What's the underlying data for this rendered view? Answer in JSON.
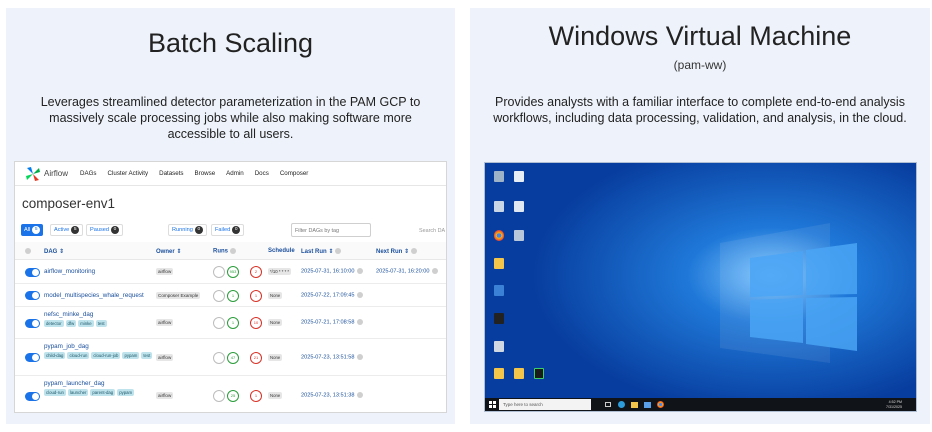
{
  "left_panel": {
    "title": "Batch Scaling",
    "description": "Leverages streamlined detector parameterization in the PAM GCP to massively scale processing jobs while also making software more accessible to all users.",
    "airflow": {
      "brand": "Airflow",
      "nav": [
        "DAGs",
        "Cluster Activity",
        "Datasets",
        "Browse",
        "Admin",
        "Docs",
        "Composer"
      ],
      "environment": "composer-env1",
      "filters": {
        "all": "All",
        "all_count": "5",
        "active": "Active",
        "active_count": "5",
        "paused": "Paused",
        "paused_count": "0",
        "running": "Running",
        "running_count": "0",
        "failed": "Failed",
        "failed_count": "0"
      },
      "filter_tags_placeholder": "Filter DAGs by tag",
      "search_placeholder": "Search DA",
      "columns": {
        "dag": "DAG ⇕",
        "owner": "Owner ⇕",
        "runs": "Runs",
        "schedule": "Schedule",
        "last_run": "Last Run ⇕",
        "next_run": "Next Run ⇕"
      },
      "rows": [
        {
          "name": "airflow_monitoring",
          "tags": [],
          "owner": "airflow",
          "success": "953",
          "failed": "2",
          "schedule": "*/10 * * * *",
          "last_run": "2025-07-31, 16:10:00",
          "next_run": "2025-07-31, 16:20:00"
        },
        {
          "name": "model_multispecies_whale_request",
          "tags": [],
          "owner": "Composer Example",
          "success": "1",
          "failed": "1",
          "schedule": "None",
          "last_run": "2025-07-22, 17:09:45",
          "next_run": ""
        },
        {
          "name": "nefsc_minke_dag",
          "tags": [
            "detector",
            "dfw",
            "minke",
            "test"
          ],
          "owner": "airflow",
          "success": "1",
          "failed": "10",
          "schedule": "None",
          "last_run": "2025-07-21, 17:08:58",
          "next_run": ""
        },
        {
          "name": "pypam_job_dag",
          "tags": [
            "child-dag",
            "cloud-run",
            "cloud-run-job",
            "pypam",
            "test"
          ],
          "owner": "airflow",
          "success": "47",
          "failed": "21",
          "schedule": "None",
          "last_run": "2025-07-23, 13:51:58",
          "next_run": ""
        },
        {
          "name": "pypam_launcher_dag",
          "tags": [
            "cloud-run",
            "launcher",
            "parent-dag",
            "pypam"
          ],
          "owner": "airflow",
          "success": "25",
          "failed": "1",
          "schedule": "None",
          "last_run": "2025-07-23, 13:51:38",
          "next_run": ""
        }
      ]
    }
  },
  "right_panel": {
    "title": "Windows Virtual Machine",
    "subtitle": "(pam-ww)",
    "description": "Provides analysts with a familiar interface to complete end-to-end analysis workflows, including data processing, validation, and analysis, in the cloud.",
    "taskbar_search": "Type here to search",
    "tray_time": "4:52 PM",
    "tray_date": "7/31/2025"
  },
  "colors": {
    "panel_bg": "#eef3fb",
    "airflow_blue": "#1a73e8",
    "win_blue": "#0b4fb4"
  }
}
